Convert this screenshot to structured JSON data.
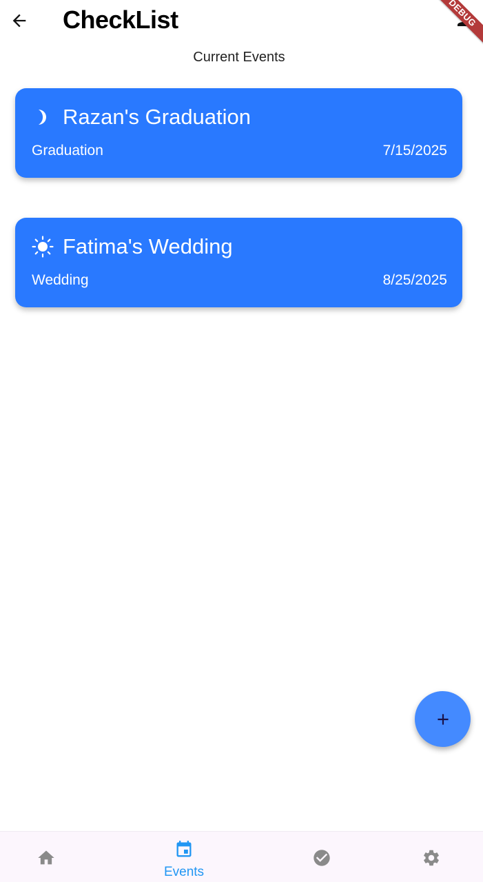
{
  "app": {
    "title": "CheckList",
    "debug_banner": "DEBUG"
  },
  "section_label": "Current Events",
  "events": [
    {
      "title": "Razan's Graduation",
      "type": "Graduation",
      "date": "7/15/2025",
      "icon": "moon-icon"
    },
    {
      "title": "Fatima's Wedding",
      "type": "Wedding",
      "date": "8/25/2025",
      "icon": "sun-icon"
    }
  ],
  "bottom_nav": {
    "items": [
      {
        "icon": "home-icon",
        "label": "",
        "active": false
      },
      {
        "icon": "calendar-icon",
        "label": "Events",
        "active": true
      },
      {
        "icon": "check-circle-icon",
        "label": "",
        "active": false
      },
      {
        "icon": "gear-icon",
        "label": "",
        "active": false
      }
    ]
  },
  "colors": {
    "card": "#2979ff",
    "fab": "#448aff",
    "nav_active": "#2196f3",
    "nav_inactive": "#8a8a8a",
    "nav_background": "#fcf6fd",
    "debug_banner": "#b33a3a"
  }
}
